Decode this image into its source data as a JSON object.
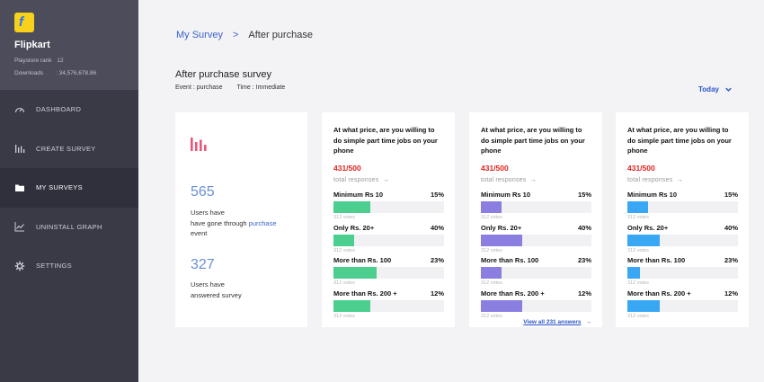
{
  "sidebar": {
    "brand": "Flipkart",
    "playstore_label": "Playstore rank",
    "playstore_value": "12",
    "downloads_label": "Downloads",
    "downloads_value": ": 34,576,678.86",
    "items": [
      {
        "label": "DASHBOARD",
        "icon": "gauge-icon"
      },
      {
        "label": "CREATE SURVEY",
        "icon": "bar-chart-icon"
      },
      {
        "label": "MY SURVEYS",
        "icon": "folder-icon",
        "active": true
      },
      {
        "label": "UNINSTALL GRAPH",
        "icon": "line-chart-icon"
      },
      {
        "label": "SETTINGS",
        "icon": "gear-icon"
      }
    ]
  },
  "breadcrumb": {
    "root": "My Survey",
    "sep": ">",
    "current": "After purchase"
  },
  "page": {
    "title": "After purchase survey",
    "event": "Event : purchase",
    "time": "Time : Immediate",
    "filter": "Today"
  },
  "stats": {
    "count1": "565",
    "text1a": "Users have",
    "text1b": "have gone through",
    "text1link": "purchase",
    "text1c": "event",
    "count2": "327",
    "text2a": "Users have",
    "text2b": "answered survey"
  },
  "colors": {
    "accent": "#2a55c9",
    "green": "#4ccf8e",
    "purple": "#8a7fe0",
    "blue": "#38a8f5",
    "red": "#e0211d",
    "pink": "#e8587a"
  },
  "cards": [
    {
      "question": "At what price, are you willing to do simple part time jobs on your phone",
      "count": "431/500",
      "total": "total responses",
      "color": "#4ccf8e",
      "options": [
        {
          "label": "Minimum Rs 10",
          "pct": "15%",
          "fill": 0.33,
          "votes": "312 votes"
        },
        {
          "label": "Only Rs. 20+",
          "pct": "40%",
          "fill": 0.19,
          "votes": "312 votes"
        },
        {
          "label": "More than Rs. 100",
          "pct": "23%",
          "fill": 0.39,
          "votes": "312 votes"
        },
        {
          "label": "More than Rs. 200 +",
          "pct": "12%",
          "fill": 0.33,
          "votes": "312 votes"
        }
      ]
    },
    {
      "question": "At what price, are you willing to do simple part time jobs on your phone",
      "count": "431/500",
      "total": "total responses",
      "color": "#8a7fe0",
      "view_all": "View all 231 answers",
      "options": [
        {
          "label": "Minimum Rs 10",
          "pct": "15%",
          "fill": 0.19,
          "votes": "312 votes"
        },
        {
          "label": "Only Rs. 20+",
          "pct": "40%",
          "fill": 0.37,
          "votes": "312 votes"
        },
        {
          "label": "More than Rs. 100",
          "pct": "23%",
          "fill": 0.19,
          "votes": "312 votes"
        },
        {
          "label": "More than Rs. 200 +",
          "pct": "12%",
          "fill": 0.37,
          "votes": "312 votes"
        }
      ]
    },
    {
      "question": "At what price, are you willing to do simple part time jobs on your phone",
      "count": "431/500",
      "total": "total responses",
      "color": "#38a8f5",
      "options": [
        {
          "label": "Minimum Rs 10",
          "pct": "15%",
          "fill": 0.19,
          "votes": "312 votes"
        },
        {
          "label": "Only Rs. 20+",
          "pct": "40%",
          "fill": 0.29,
          "votes": "312 votes"
        },
        {
          "label": "More than Rs. 100",
          "pct": "23%",
          "fill": 0.11,
          "votes": "312 votes"
        },
        {
          "label": "More than Rs. 200 +",
          "pct": "12%",
          "fill": 0.29,
          "votes": "312 votes"
        }
      ]
    }
  ]
}
